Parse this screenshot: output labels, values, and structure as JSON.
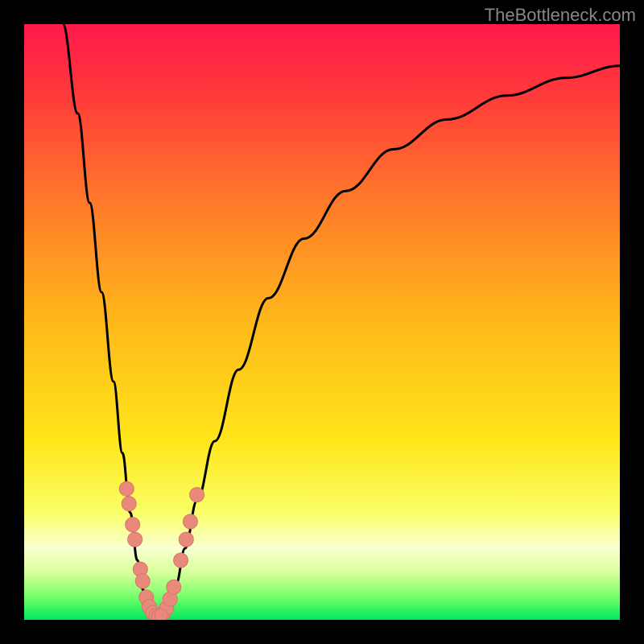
{
  "watermark": "TheBottleneck.com",
  "colors": {
    "bg": "#000000",
    "watermark_text": "#888888",
    "curve": "#000000",
    "marker_fill": "#e8897b",
    "marker_stroke": "#d4786a"
  },
  "chart_data": {
    "type": "line",
    "title": "",
    "xlabel": "",
    "ylabel": "",
    "xlim": [
      0,
      100
    ],
    "ylim": [
      0,
      100
    ],
    "gradient_stops": [
      {
        "offset": 0,
        "color": "#ff1a4a"
      },
      {
        "offset": 12,
        "color": "#ff3a3a"
      },
      {
        "offset": 30,
        "color": "#ff7a2a"
      },
      {
        "offset": 50,
        "color": "#ffb81a"
      },
      {
        "offset": 70,
        "color": "#ffe61a"
      },
      {
        "offset": 82,
        "color": "#faff66"
      },
      {
        "offset": 88,
        "color": "#f8ffd0"
      },
      {
        "offset": 92,
        "color": "#d8ff9a"
      },
      {
        "offset": 96,
        "color": "#7aff6a"
      },
      {
        "offset": 100,
        "color": "#00e860"
      }
    ],
    "curve_points": [
      {
        "x": 6.5,
        "y": 100
      },
      {
        "x": 9,
        "y": 85
      },
      {
        "x": 11,
        "y": 70
      },
      {
        "x": 13,
        "y": 55
      },
      {
        "x": 15,
        "y": 40
      },
      {
        "x": 16.5,
        "y": 28
      },
      {
        "x": 17.8,
        "y": 18
      },
      {
        "x": 19,
        "y": 10
      },
      {
        "x": 20,
        "y": 5
      },
      {
        "x": 21,
        "y": 2
      },
      {
        "x": 22,
        "y": 0.5
      },
      {
        "x": 23,
        "y": 0.5
      },
      {
        "x": 24,
        "y": 2
      },
      {
        "x": 25.5,
        "y": 6
      },
      {
        "x": 27,
        "y": 12
      },
      {
        "x": 29,
        "y": 20
      },
      {
        "x": 32,
        "y": 30
      },
      {
        "x": 36,
        "y": 42
      },
      {
        "x": 41,
        "y": 54
      },
      {
        "x": 47,
        "y": 64
      },
      {
        "x": 54,
        "y": 72
      },
      {
        "x": 62,
        "y": 79
      },
      {
        "x": 71,
        "y": 84
      },
      {
        "x": 81,
        "y": 88
      },
      {
        "x": 91,
        "y": 91
      },
      {
        "x": 100,
        "y": 93
      }
    ],
    "left_markers": [
      {
        "x": 17.2,
        "y": 22
      },
      {
        "x": 17.6,
        "y": 19.5
      },
      {
        "x": 18.2,
        "y": 16
      },
      {
        "x": 18.6,
        "y": 13.5
      },
      {
        "x": 19.5,
        "y": 8.5
      },
      {
        "x": 19.9,
        "y": 6.5
      },
      {
        "x": 20.5,
        "y": 3.8
      },
      {
        "x": 21.0,
        "y": 2.2
      },
      {
        "x": 21.6,
        "y": 1.2
      }
    ],
    "right_markers": [
      {
        "x": 23.4,
        "y": 1.2
      },
      {
        "x": 23.9,
        "y": 2.0
      },
      {
        "x": 24.5,
        "y": 3.5
      },
      {
        "x": 25.1,
        "y": 5.5
      },
      {
        "x": 26.3,
        "y": 10.0
      },
      {
        "x": 27.2,
        "y": 13.5
      },
      {
        "x": 27.9,
        "y": 16.5
      },
      {
        "x": 29.0,
        "y": 21.0
      }
    ],
    "bottom_markers": [
      {
        "x": 22.0,
        "y": 0.8
      },
      {
        "x": 22.5,
        "y": 0.6
      },
      {
        "x": 23.0,
        "y": 0.8
      }
    ]
  }
}
